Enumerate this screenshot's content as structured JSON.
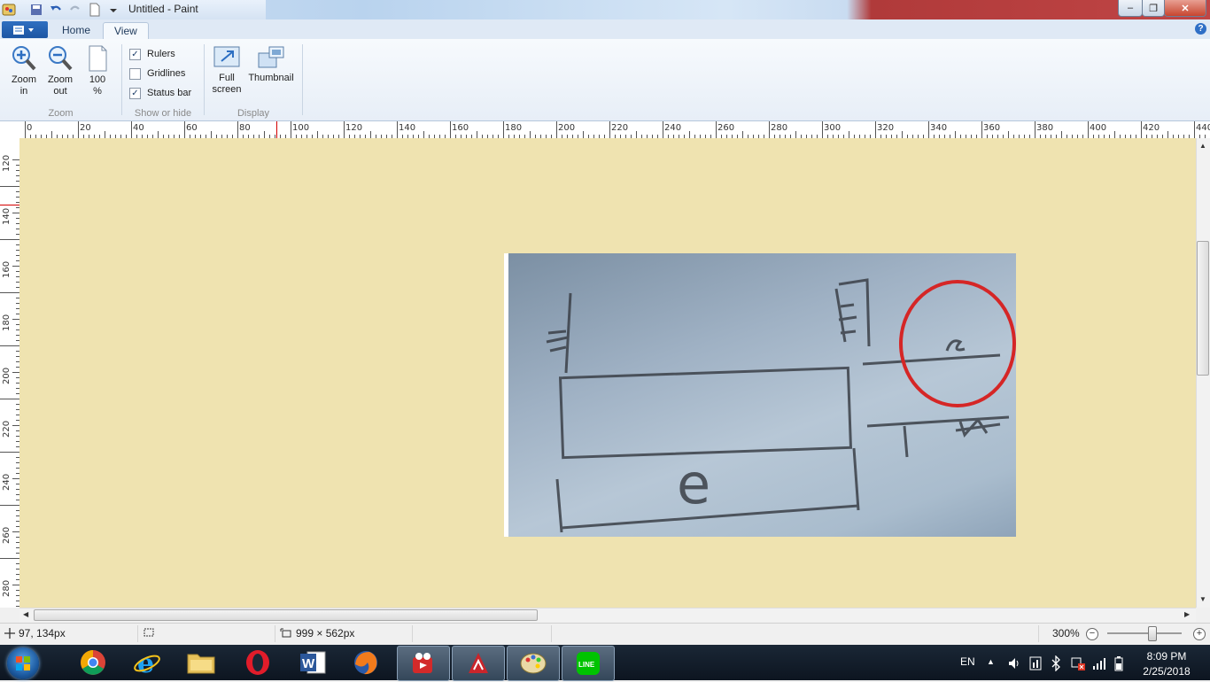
{
  "window": {
    "title": "Untitled - Paint",
    "minimize": "–",
    "maximize": "❐",
    "close": "✕"
  },
  "ribbon": {
    "tabs": [
      {
        "label": "Home"
      },
      {
        "label": "View"
      }
    ],
    "active_tab": "View",
    "zoom_group": {
      "label": "Zoom",
      "zoom_in": "Zoom in",
      "zoom_out": "Zoom out",
      "hundred": "100 %"
    },
    "show_hide_group": {
      "label": "Show or hide",
      "rulers": {
        "label": "Rulers",
        "checked": true
      },
      "gridlines": {
        "label": "Gridlines",
        "checked": false
      },
      "status_bar": {
        "label": "Status bar",
        "checked": true
      }
    },
    "display_group": {
      "label": "Display",
      "full_screen": "Full screen",
      "thumbnail": "Thumbnail"
    },
    "help": "?"
  },
  "rulers": {
    "horizontal_labels": [
      "0",
      "20",
      "40",
      "60",
      "80",
      "100",
      "120",
      "140",
      "160",
      "180",
      "200",
      "220",
      "240",
      "260",
      "280",
      "300",
      "320",
      "340",
      "360",
      "380",
      "400",
      "420",
      "440"
    ],
    "vertical_labels": [
      "120",
      "140",
      "160",
      "180",
      "200",
      "220",
      "240",
      "260",
      "280"
    ]
  },
  "canvas": {
    "background": "#efe3b0",
    "image_text": "e"
  },
  "statusbar": {
    "cursor_position": "97, 134px",
    "image_size": "999 × 562px",
    "zoom": "300%",
    "zoom_level_fraction": 0.6
  },
  "taskbar": {
    "apps": [
      "chrome-icon",
      "internet-explorer-icon",
      "file-explorer-icon",
      "opera-icon",
      "word-icon",
      "firefox-icon",
      "video-app-icon",
      "pdf-icon",
      "paint-icon",
      "line-icon"
    ],
    "line_label": "LINE",
    "word_label": "W",
    "language": "EN",
    "time": "8:09 PM",
    "date": "2/25/2018"
  }
}
